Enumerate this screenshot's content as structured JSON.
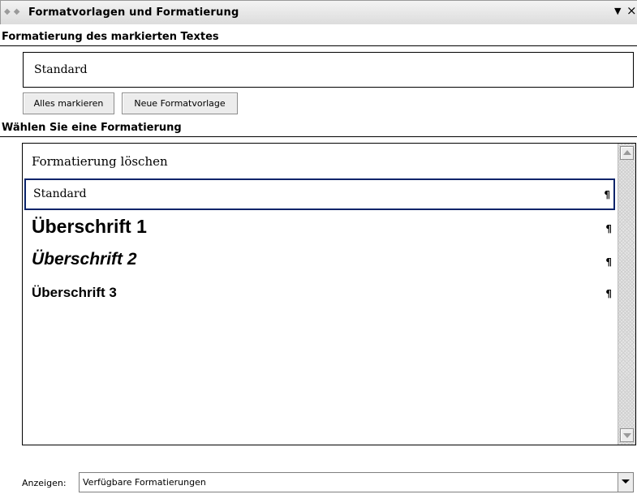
{
  "panel": {
    "title": "Formatvorlagen und Formatierung",
    "dropdown_glyph": "▼",
    "close_glyph": "×",
    "nav_back_glyph": "◆",
    "nav_forward_glyph": "◆"
  },
  "selected_text_section": {
    "header": "Formatierung des markierten Textes",
    "current_style": "Standard",
    "buttons": {
      "select_all": "Alles markieren",
      "new_style": "Neue Formatvorlage"
    }
  },
  "choose_section": {
    "header": "Wählen Sie eine Formatierung",
    "items": [
      {
        "label": "Formatierung löschen",
        "mark": ""
      },
      {
        "label": "Standard",
        "mark": "¶",
        "selected": true
      },
      {
        "label": "Überschrift 1",
        "mark": "¶"
      },
      {
        "label": "Überschrift 2",
        "mark": "¶"
      },
      {
        "label": "Überschrift 3",
        "mark": "¶"
      }
    ]
  },
  "show": {
    "label": "Anzeigen:",
    "value": "Verfügbare Formatierungen"
  },
  "icons": {
    "scroll_up": "scroll-up-arrow-icon",
    "scroll_down": "scroll-down-arrow-icon",
    "dropdown": "chevron-down-icon",
    "pilcrow": "pilcrow-icon"
  },
  "colors": {
    "selection_border": "#0a246a",
    "titlebar": "#dcdcdc",
    "button_face": "#ececec"
  }
}
